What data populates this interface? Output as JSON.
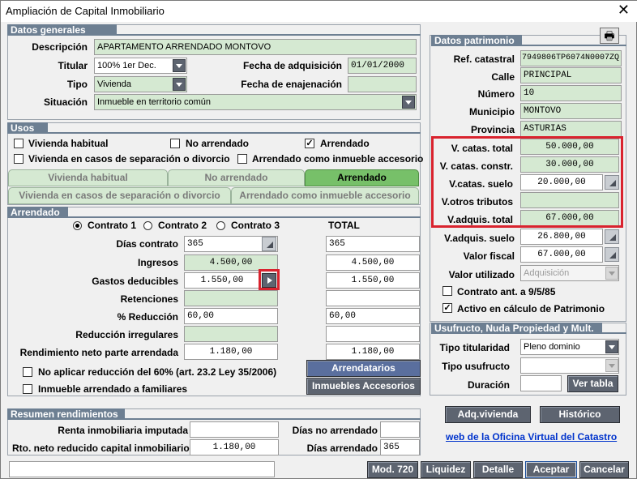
{
  "window": {
    "title": "Ampliación de Capital Inmobiliario"
  },
  "datos_generales": {
    "header": "Datos generales",
    "descripcion_label": "Descripción",
    "descripcion": "APARTAMENTO ARRENDADO MONTOVO",
    "titular_label": "Titular",
    "titular": "100% 1er Dec.",
    "fecha_adq_label": "Fecha de adquisición",
    "fecha_adq": "01/01/2000",
    "tipo_label": "Tipo",
    "tipo": "Vivienda",
    "fecha_enaj_label": "Fecha de enajenación",
    "fecha_enaj": "",
    "situacion_label": "Situación",
    "situacion": "Inmueble en territorio común"
  },
  "usos": {
    "header": "Usos",
    "checks": [
      {
        "label": "Vivienda habitual",
        "checked": false
      },
      {
        "label": "No arrendado",
        "checked": false
      },
      {
        "label": "Arrendado",
        "checked": true
      },
      {
        "label": "Vivienda en casos de separación o divorcio",
        "checked": false
      },
      {
        "label": "Arrendado como inmueble accesorio",
        "checked": false
      }
    ],
    "check_mark": "✓",
    "tabs_row1": [
      "Vivienda habitual",
      "No arrendado",
      "Arrendado"
    ],
    "tabs_row2": [
      "Vivienda en casos de separación o divorcio",
      "Arrendado como inmueble accesorio"
    ],
    "active_tab": "Arrendado"
  },
  "arrendado": {
    "header": "Arrendado",
    "contrato1": "Contrato 1",
    "contrato2": "Contrato 2",
    "contrato3": "Contrato 3",
    "selected_contrato": 1,
    "total_label": "TOTAL",
    "rows": [
      {
        "label": "Días contrato",
        "value": "365",
        "total": "365"
      },
      {
        "label": "Ingresos",
        "value": "4.500,00",
        "total": "4.500,00"
      },
      {
        "label": "Gastos deducibles",
        "value": "1.550,00",
        "total": "1.550,00"
      },
      {
        "label": "Retenciones",
        "value": "",
        "total": ""
      },
      {
        "label": "% Reducción",
        "value": "60,00",
        "total": "60,00"
      },
      {
        "label": "Reducción irregulares",
        "value": "",
        "total": ""
      },
      {
        "label": "Rendimiento neto parte arrendada",
        "value": "1.180,00",
        "total": "1.180,00"
      }
    ],
    "no_aplicar_label": "No aplicar reducción del 60% (art. 23.2 Ley 35/2006)",
    "inmueble_familiares_label": "Inmueble arrendado a familiares",
    "arrendatarios_btn": "Arrendatarios",
    "inmuebles_accesorios_btn": "Inmuebles Accesorios"
  },
  "resumen": {
    "header": "Resumen rendimientos",
    "renta_label": "Renta inmobiliaria imputada",
    "renta": "",
    "rto_label": "Rto. neto reducido capital inmobiliario",
    "rto": "1.180,00",
    "dias_no_label": "Días no arrendado",
    "dias_no": "",
    "dias_arr_label": "Días arrendado",
    "dias_arr": "365"
  },
  "datos_patrimonio": {
    "header": "Datos patrimonio",
    "ref_label": "Ref. catastral",
    "ref": "7949806TP6074N0007ZQ",
    "calle_label": "Calle",
    "calle": "PRINCIPAL",
    "numero_label": "Número",
    "numero": "10",
    "municipio_label": "Municipio",
    "municipio": "MONTOVO",
    "provincia_label": "Provincia",
    "provincia": "ASTURIAS",
    "vcat_total_label": "V. catas. total",
    "vcat_total": "50.000,00",
    "vcat_constr_label": "V. catas. constr.",
    "vcat_constr": "30.000,00",
    "vcat_suelo_label": "V.catas. suelo",
    "vcat_suelo": "20.000,00",
    "votros_label": "V.otros tributos",
    "votros": "",
    "vadq_total_label": "V.adquis. total",
    "vadq_total": "67.000,00",
    "vadq_suelo_label": "V.adquis. suelo",
    "vadq_suelo": "26.800,00",
    "vfiscal_label": "Valor fiscal",
    "vfiscal": "67.000,00",
    "vutil_label": "Valor utilizado",
    "vutil": "Adquisición",
    "contrato_ant_label": "Contrato ant. a 9/5/85",
    "contrato_ant_checked": false,
    "activo_label": "Activo en cálculo de Patrimonio",
    "activo_checked": true
  },
  "usufructo": {
    "header": "Usufructo, Nuda Propiedad y Mult.",
    "tipo_tit_label": "Tipo titularidad",
    "tipo_tit": "Pleno dominio",
    "tipo_usuf_label": "Tipo usufructo",
    "tipo_usuf": "",
    "duracion_label": "Duración",
    "duracion": "",
    "ver_tabla_btn": "Ver tabla"
  },
  "right_buttons": {
    "adq_vivienda": "Adq.vivienda",
    "historico": "Histórico",
    "catastro_link": "web de la Oficina Virtual del Catastro"
  },
  "footer": {
    "status_text": "",
    "buttons": [
      "Mod. 720",
      "Liquidez",
      "Detalle",
      "Aceptar",
      "Cancelar"
    ]
  },
  "colors": {
    "accent_green": "#77c069",
    "field_green": "#d5e9d2",
    "header_gray": "#6d7f92",
    "highlight_red": "#d9232e"
  }
}
